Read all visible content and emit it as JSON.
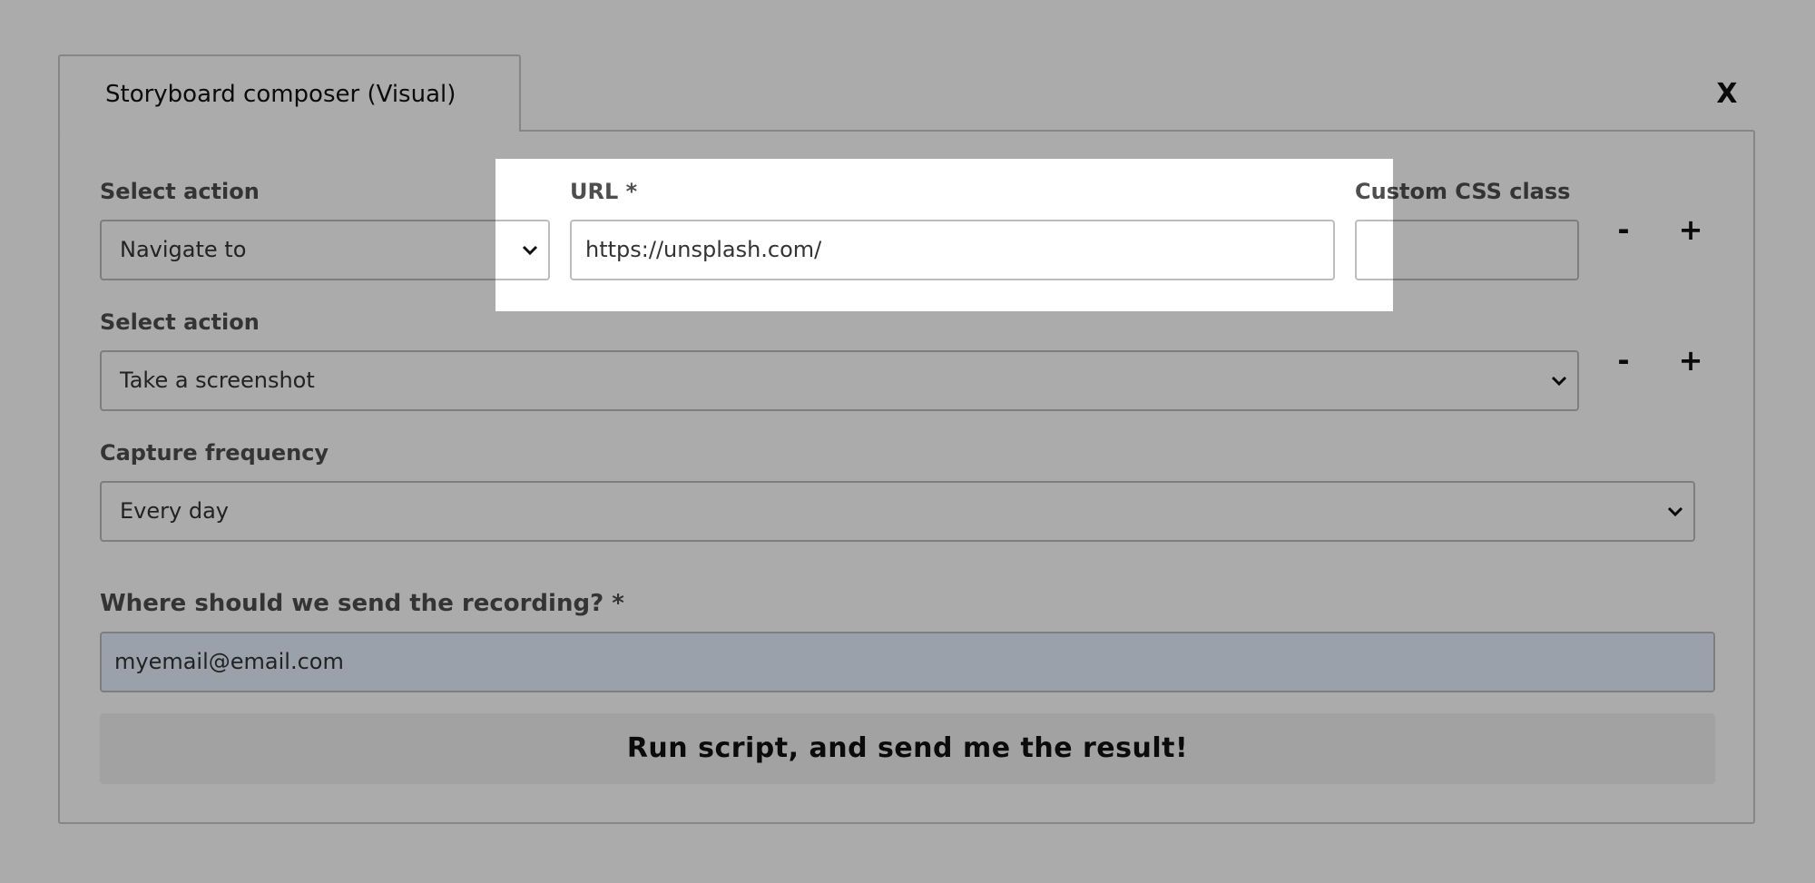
{
  "dialog": {
    "tab_title": "Storyboard composer (Visual)",
    "close_label": "X"
  },
  "row1": {
    "action_label": "Select action",
    "action_value": "Navigate to",
    "url_label": "URL *",
    "url_value": "https://unsplash.com/",
    "css_label": "Custom CSS class",
    "css_value": "",
    "remove_label": "-",
    "add_label": "+"
  },
  "row2": {
    "action_label": "Select action",
    "action_value": "Take a screenshot",
    "remove_label": "-",
    "add_label": "+"
  },
  "frequency": {
    "label": "Capture frequency",
    "value": "Every day"
  },
  "recipient": {
    "label": "Where should we send the recording? *",
    "value": "myemail@email.com"
  },
  "submit": {
    "label": "Run script, and send me the result!"
  },
  "icons": {
    "dropdown": "chevron-down-icon"
  }
}
